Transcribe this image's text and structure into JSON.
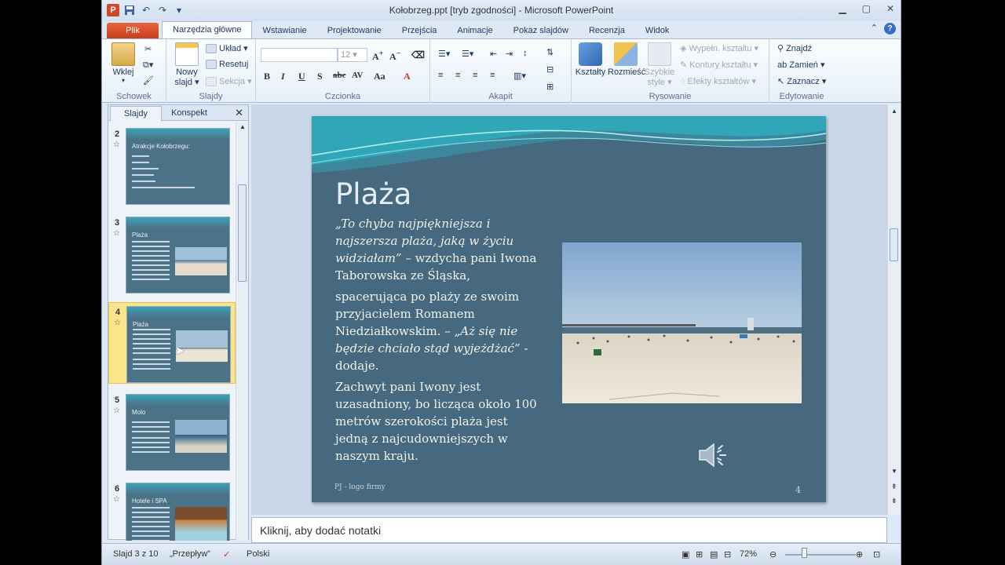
{
  "window": {
    "title": "Kołobrzeg.ppt [tryb zgodności] - Microsoft PowerPoint",
    "app_icon": "P",
    "controls": [
      "minimize-icon",
      "maximize-icon",
      "close-icon"
    ]
  },
  "qat": [
    "save-icon",
    "undo-icon",
    "redo-icon",
    "customize-icon"
  ],
  "tabs": [
    {
      "label": "Plik"
    },
    {
      "label": "Narzędzia główne"
    },
    {
      "label": "Wstawianie"
    },
    {
      "label": "Projektowanie"
    },
    {
      "label": "Przejścia"
    },
    {
      "label": "Animacje"
    },
    {
      "label": "Pokaz slajdów"
    },
    {
      "label": "Recenzja"
    },
    {
      "label": "Widok"
    }
  ],
  "ribbon": {
    "schowek": {
      "label": "Schowek",
      "paste": "Wklej"
    },
    "slajdy": {
      "label": "Slajdy",
      "new_slide": "Nowy slajd ▾",
      "layout": "Układ ▾",
      "reset": "Resetuj",
      "section": "Sekcja ▾"
    },
    "czcionka": {
      "label": "Czcionka",
      "font_name": "",
      "font_size": "12"
    },
    "akapit": {
      "label": "Akapit"
    },
    "rysowanie": {
      "label": "Rysowanie",
      "shapes": "Kształty",
      "arrange": "Rozmieść",
      "quick_styles": "Szybkie style ▾",
      "fill": "Wypełn. kształtu ▾",
      "outline": "Kontury kształtu ▾",
      "effects": "Efekty kształtów ▾"
    },
    "edytowanie": {
      "label": "Edytowanie",
      "find": "Znajdź",
      "replace": "Zamień ▾",
      "select": "Zaznacz ▾"
    }
  },
  "panel": {
    "tab_slides": "Slajdy",
    "tab_outline": "Konspekt",
    "slides": [
      {
        "num": "2",
        "title": "Atrakcje Kołobrzegu:"
      },
      {
        "num": "3",
        "title": "Plaża"
      },
      {
        "num": "4",
        "title": "Plaża",
        "selected": true
      },
      {
        "num": "5",
        "title": "Molo"
      },
      {
        "num": "6",
        "title": "Hotele i SPA"
      }
    ]
  },
  "slide": {
    "title": "Plaża",
    "p1_quote": "„To chyba najpiękniejsza i najszersza plaża, jaką w życiu widziałam”",
    "p1_rest": " – wzdycha pani Iwona Taborowska ze Śląska,",
    "p2_start": " spacerująca po plaży ze swoim przyjacielem Romanem Niedziałkowskim. – ",
    "p2_quote": "„Aż się nie będzie chciało stąd wyjeżdżać”",
    "p2_end": " - dodaje.",
    "p3": "Zachwyt pani Iwony jest uzasadniony, bo licząca około 100 metrów szerokości plaża jest jedną z najcudowniejszych w naszym kraju.",
    "footer": "PJ - logo firmy",
    "page_number": "4"
  },
  "notes": {
    "placeholder": "Kliknij, aby dodać notatki"
  },
  "status": {
    "slide_info": "Slajd 3 z 10",
    "theme": "„Przepływ”",
    "language": "Polski",
    "zoom": "72%"
  }
}
